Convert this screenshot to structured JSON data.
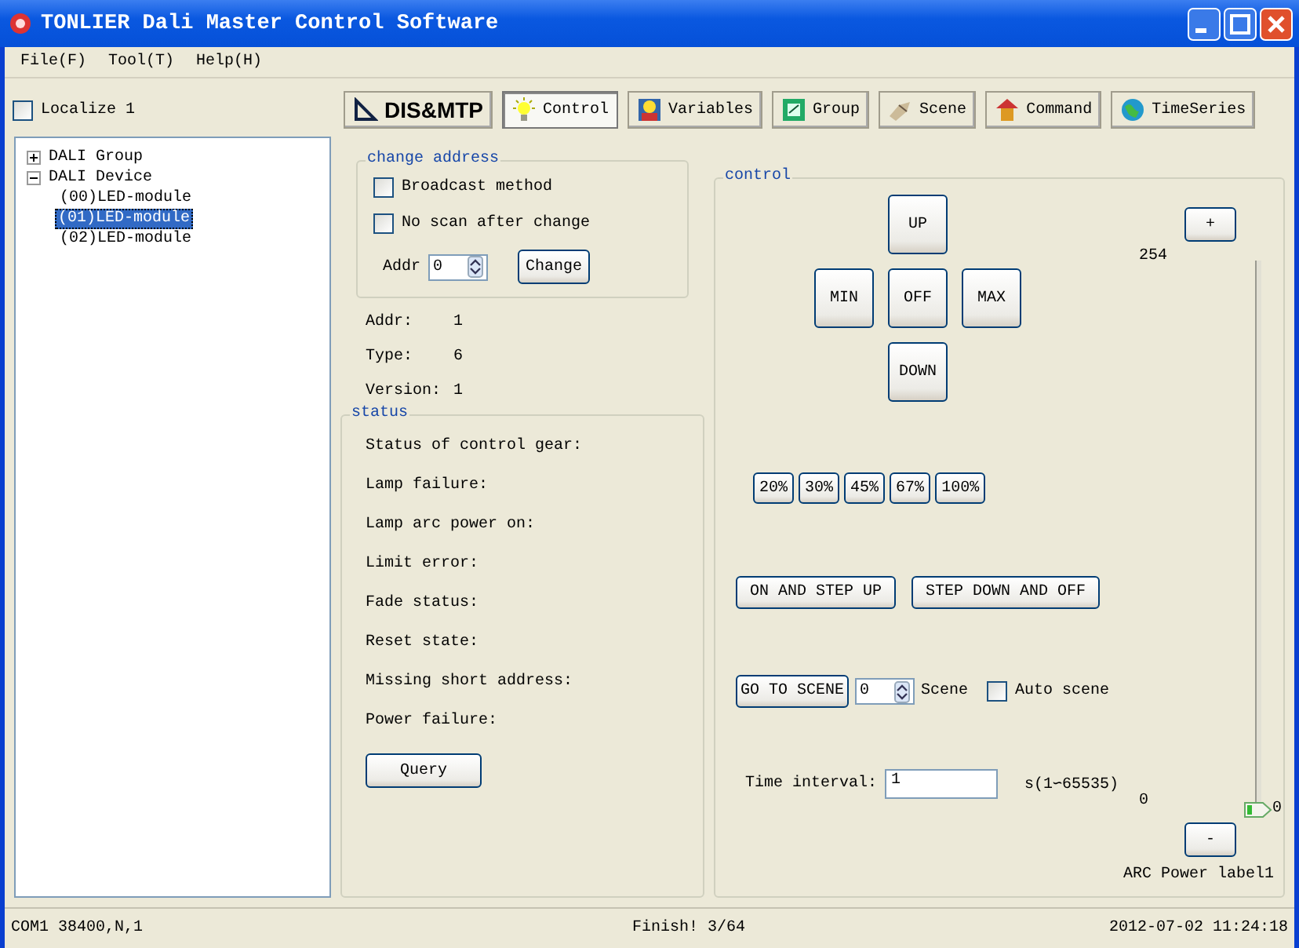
{
  "window": {
    "title": "TONLIER Dali Master Control Software"
  },
  "menu": [
    "File(F)",
    "Tool(T)",
    "Help(H)"
  ],
  "localize": {
    "label": "Localize 1",
    "checked": false
  },
  "tabs": [
    {
      "label": "DIS&MTP",
      "selected": false
    },
    {
      "label": "Control",
      "selected": true
    },
    {
      "label": "Variables",
      "selected": false
    },
    {
      "label": "Group",
      "selected": false
    },
    {
      "label": "Scene",
      "selected": false
    },
    {
      "label": "Command",
      "selected": false
    },
    {
      "label": "TimeSeries",
      "selected": false
    }
  ],
  "tree": [
    {
      "label": "DALI Group",
      "expanded": false,
      "selected": false
    },
    {
      "label": "DALI Device",
      "expanded": true,
      "selected": false,
      "children": [
        {
          "label": "(00)LED-module",
          "selected": false
        },
        {
          "label": "(01)LED-module",
          "selected": true
        },
        {
          "label": "(02)LED-module",
          "selected": false
        }
      ]
    }
  ],
  "change_address": {
    "title": "change address",
    "options": [
      {
        "label": "Broadcast method",
        "checked": false
      },
      {
        "label": "No scan after change",
        "checked": false
      }
    ],
    "addr_label": "Addr",
    "addr_value": "0",
    "button": "Change"
  },
  "info": [
    {
      "label": "Addr:",
      "value": "1"
    },
    {
      "label": "Type:",
      "value": "6"
    },
    {
      "label": "Version:",
      "value": "1"
    }
  ],
  "status": {
    "title": "status",
    "items": [
      "Status of control gear:",
      "Lamp failure:",
      "Lamp arc power on:",
      "Limit error:",
      "Fade status:",
      "Reset state:",
      "Missing short address:",
      "Power failure:"
    ],
    "button": "Query"
  },
  "control": {
    "title": "control",
    "up": "UP",
    "min": "MIN",
    "off": "OFF",
    "max": "MAX",
    "down": "DOWN",
    "percent_buttons": [
      "20%",
      "30%",
      "45%",
      "67%",
      "100%"
    ],
    "step_buttons": [
      "ON AND STEP UP",
      "STEP DOWN AND OFF"
    ],
    "scene": {
      "button": "GO TO SCENE",
      "value": "0",
      "label": "Scene",
      "auto": {
        "label": "Auto scene",
        "checked": false
      }
    },
    "interval": {
      "label": "Time interval:",
      "value": "1",
      "unit": "s(1∽65535)"
    },
    "slider": {
      "plus": "+",
      "max_label": "254",
      "min_label": "0",
      "thumb_label": "0",
      "level": 0,
      "minus": "-",
      "caption": "ARC Power label1"
    }
  },
  "status_bar": [
    "COM1 38400,N,1",
    "Finish! 3/64",
    "2012-07-02 11:24:18"
  ]
}
